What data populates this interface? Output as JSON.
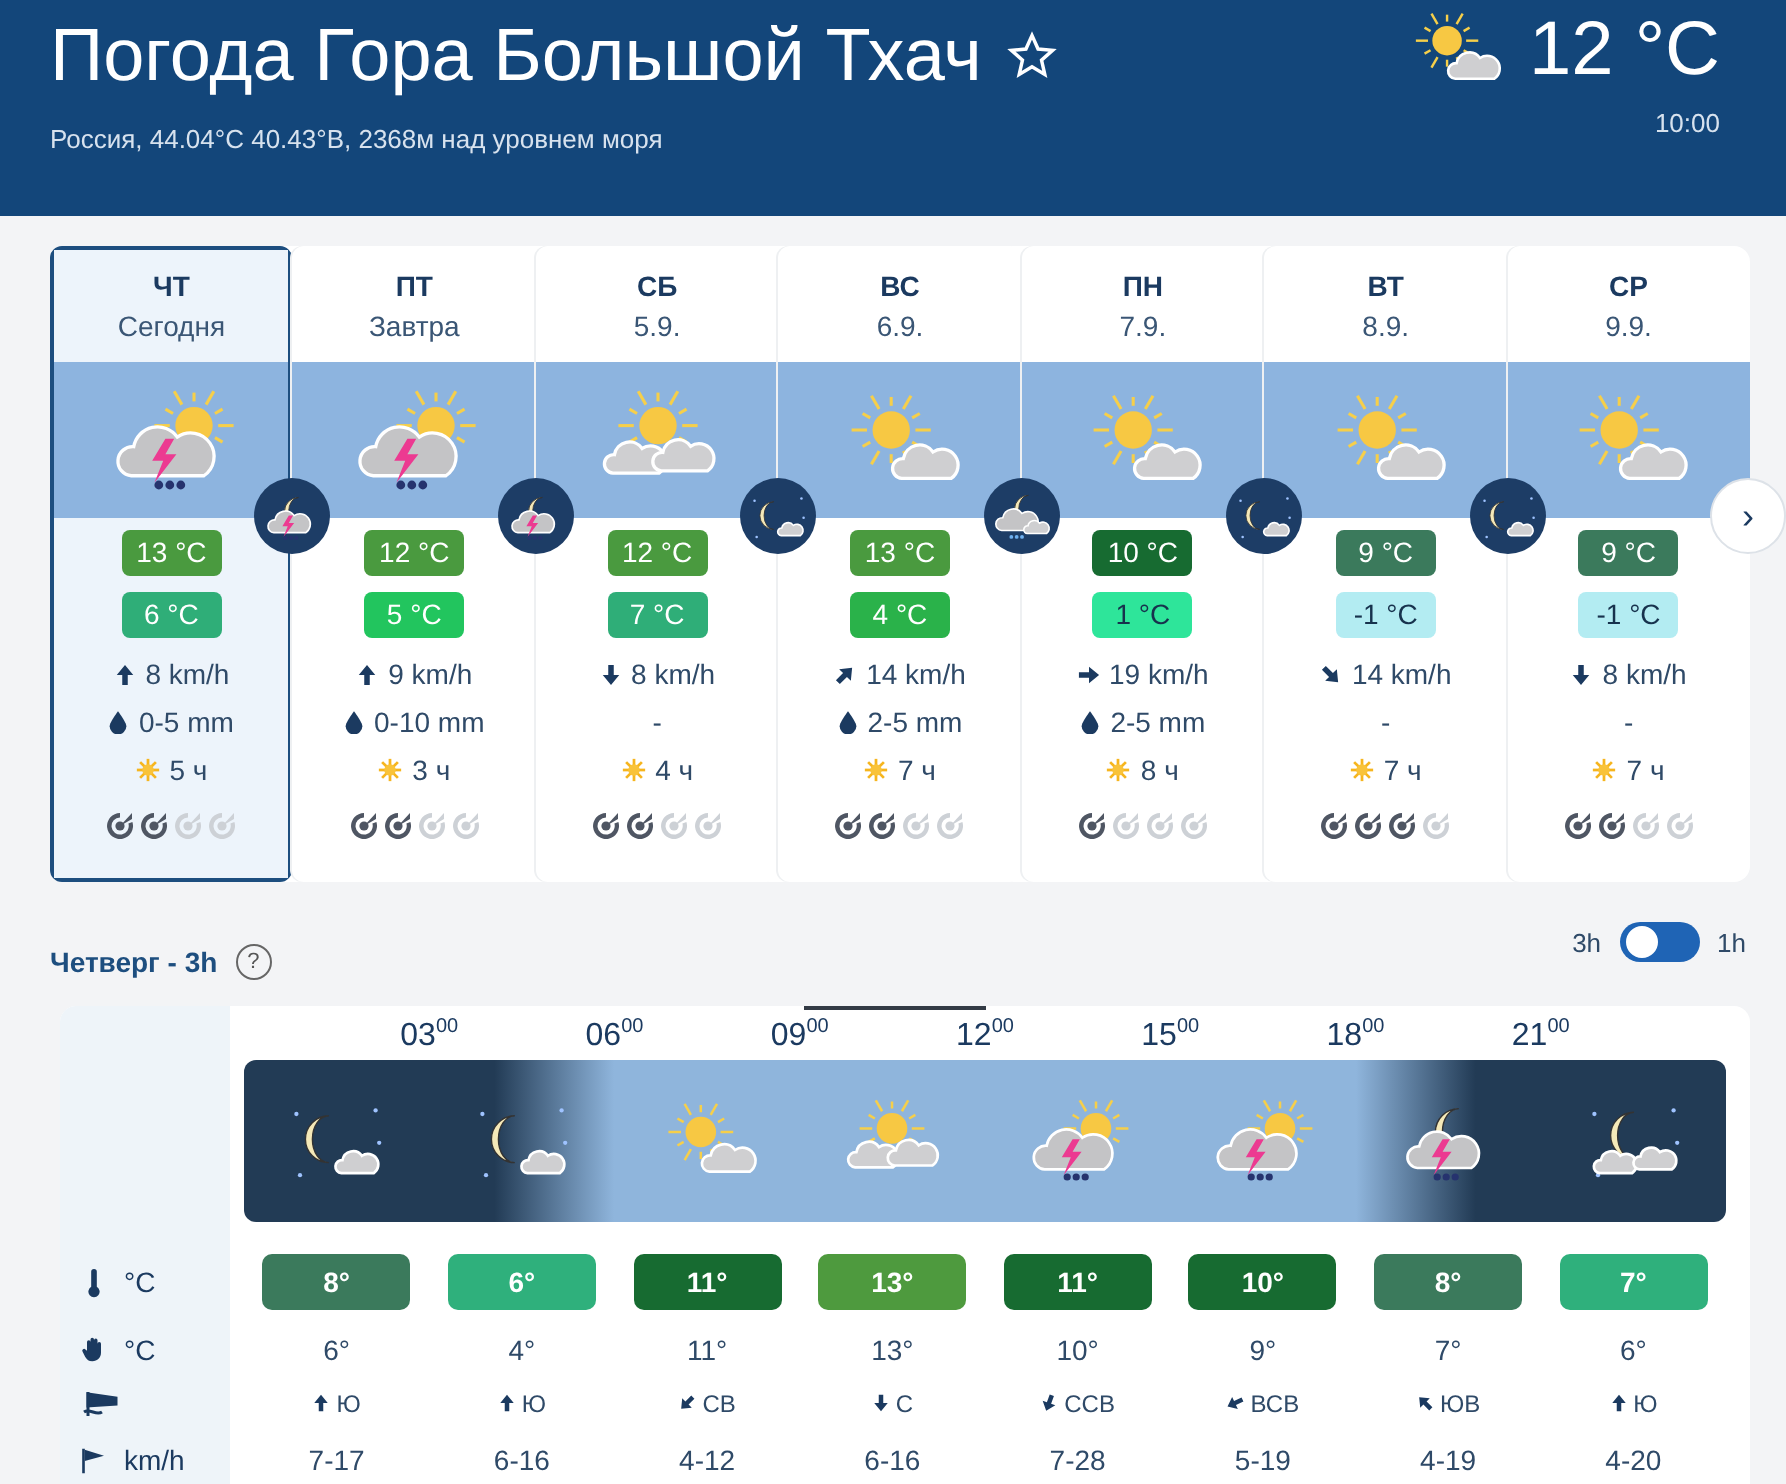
{
  "header": {
    "title": "Погода Гора Большой Тхач",
    "subtitle": "Россия, 44.04°С 40.43°В, 2368м над уровнем моря",
    "weather": {
      "kind": "partly"
    },
    "temp": "12 °C",
    "time": "10:00"
  },
  "days": [
    {
      "weekday": "ЧТ",
      "date": "Сегодня",
      "selected": true,
      "weather": {
        "kind": "storm"
      },
      "night": {
        "kind": "moon-storm"
      },
      "max": {
        "text": "13 °C",
        "color": "#4a9a3f"
      },
      "min": {
        "text": "6 °C",
        "color": "#2fae78"
      },
      "wind": {
        "text": "8 km/h",
        "kind": "n"
      },
      "precip": "0-5 mm",
      "precip_icon": true,
      "sun": "5 ч",
      "stars": 2
    },
    {
      "weekday": "ПТ",
      "date": "Завтра",
      "selected": false,
      "weather": {
        "kind": "storm"
      },
      "night": {
        "kind": "moon-storm"
      },
      "max": {
        "text": "12 °C",
        "color": "#4a9a3f"
      },
      "min": {
        "text": "5 °C",
        "color": "#22c55e"
      },
      "wind": {
        "text": "9 km/h",
        "kind": "n"
      },
      "precip": "0-10 mm",
      "precip_icon": true,
      "sun": "3 ч",
      "stars": 2
    },
    {
      "weekday": "СБ",
      "date": "5.9.",
      "selected": false,
      "weather": {
        "kind": "sun-clouds"
      },
      "night": {
        "kind": "moon"
      },
      "max": {
        "text": "12 °C",
        "color": "#4a9a3f"
      },
      "min": {
        "text": "7 °C",
        "color": "#2fae78"
      },
      "wind": {
        "text": "8 km/h",
        "kind": "s"
      },
      "precip": "-",
      "precip_icon": false,
      "sun": "4 ч",
      "stars": 2
    },
    {
      "weekday": "ВС",
      "date": "6.9.",
      "selected": false,
      "weather": {
        "kind": "partly"
      },
      "night": {
        "kind": "moon-snow"
      },
      "max": {
        "text": "13 °C",
        "color": "#4a9a3f"
      },
      "min": {
        "text": "4 °C",
        "color": "#2ab24a"
      },
      "wind": {
        "text": "14 km/h",
        "kind": "ne"
      },
      "precip": "2-5 mm",
      "precip_icon": true,
      "sun": "7 ч",
      "stars": 2
    },
    {
      "weekday": "ПН",
      "date": "7.9.",
      "selected": false,
      "weather": {
        "kind": "partly"
      },
      "night": {
        "kind": "moon"
      },
      "max": {
        "text": "10 °C",
        "color": "#176b31"
      },
      "min": {
        "text": "1 °C",
        "color": "#2ee59a"
      },
      "wind": {
        "text": "19 km/h",
        "kind": "e"
      },
      "precip": "2-5 mm",
      "precip_icon": true,
      "sun": "8 ч",
      "stars": 1
    },
    {
      "weekday": "ВТ",
      "date": "8.9.",
      "selected": false,
      "weather": {
        "kind": "partly"
      },
      "night": {
        "kind": "moon"
      },
      "max": {
        "text": "9 °C",
        "color": "#3b7a5c"
      },
      "min": {
        "text": "-1 °C",
        "color": "#b3ecf2"
      },
      "wind": {
        "text": "14 km/h",
        "kind": "se"
      },
      "precip": "-",
      "precip_icon": false,
      "sun": "7 ч",
      "stars": 3
    },
    {
      "weekday": "СР",
      "date": "9.9.",
      "selected": false,
      "weather": {
        "kind": "partly"
      },
      "max": {
        "text": "9 °C",
        "color": "#3b7a5c"
      },
      "min": {
        "text": "-1 °C",
        "color": "#b3ecf2"
      },
      "wind": {
        "text": "8 km/h",
        "kind": "s"
      },
      "precip": "-",
      "precip_icon": false,
      "sun": "7 ч",
      "stars": 2
    }
  ],
  "next": "›",
  "hourly": {
    "title": "Четверг - 3h",
    "help": "?",
    "toggle": {
      "left": "3h",
      "right": "1h",
      "on": false
    },
    "hours": [
      "03$^{00}$",
      "06$^{00}$",
      "09$^{00}$",
      "12$^{00}$",
      "15$^{00}$",
      "18$^{00}$",
      "21$^{00}$"
    ],
    "row_labels": {
      "temp": "°C",
      "feels": "°C",
      "gust": "km/h"
    },
    "slots": [
      {
        "weather": {
          "kind": "moon"
        },
        "dark": true,
        "current": false,
        "temp": {
          "text": "8°",
          "color": "#3b7a5c"
        },
        "feels": "6°",
        "wind": {
          "kind": "n",
          "text": "Ю"
        },
        "gust": "7-17"
      },
      {
        "weather": {
          "kind": "moon"
        },
        "dark": true,
        "current": false,
        "temp": {
          "text": "6°",
          "color": "#2fb07c"
        },
        "feels": "4°",
        "wind": {
          "kind": "n",
          "text": "Ю"
        },
        "gust": "6-16"
      },
      {
        "weather": {
          "kind": "partly"
        },
        "dark": false,
        "current": false,
        "temp": {
          "text": "11°",
          "color": "#176b31"
        },
        "feels": "11°",
        "wind": {
          "kind": "sw",
          "text": "СВ"
        },
        "gust": "4-12"
      },
      {
        "weather": {
          "kind": "sun-clouds"
        },
        "dark": false,
        "current": true,
        "temp": {
          "text": "13°",
          "color": "#4e9a3e"
        },
        "feels": "13°",
        "wind": {
          "kind": "s",
          "text": "С"
        },
        "gust": "6-16"
      },
      {
        "weather": {
          "kind": "storm"
        },
        "dark": false,
        "current": false,
        "temp": {
          "text": "11°",
          "color": "#176b31"
        },
        "feels": "10°",
        "wind": {
          "kind": "ssw",
          "text": "ССВ"
        },
        "gust": "7-28"
      },
      {
        "weather": {
          "kind": "storm"
        },
        "dark": false,
        "current": false,
        "temp": {
          "text": "10°",
          "color": "#176b31"
        },
        "feels": "9°",
        "wind": {
          "kind": "wsw",
          "text": "ВСВ"
        },
        "gust": "5-19"
      },
      {
        "weather": {
          "kind": "moon-storm"
        },
        "dark": true,
        "current": false,
        "temp": {
          "text": "8°",
          "color": "#3b7a5c"
        },
        "feels": "7°",
        "wind": {
          "kind": "nw",
          "text": "ЮВ"
        },
        "gust": "4-19"
      },
      {
        "weather": {
          "kind": "moon-clouds"
        },
        "dark": true,
        "current": false,
        "temp": {
          "text": "7°",
          "color": "#2fb07c"
        },
        "feels": "6°",
        "wind": {
          "kind": "n",
          "text": "Ю"
        },
        "gust": "4-20"
      }
    ]
  }
}
